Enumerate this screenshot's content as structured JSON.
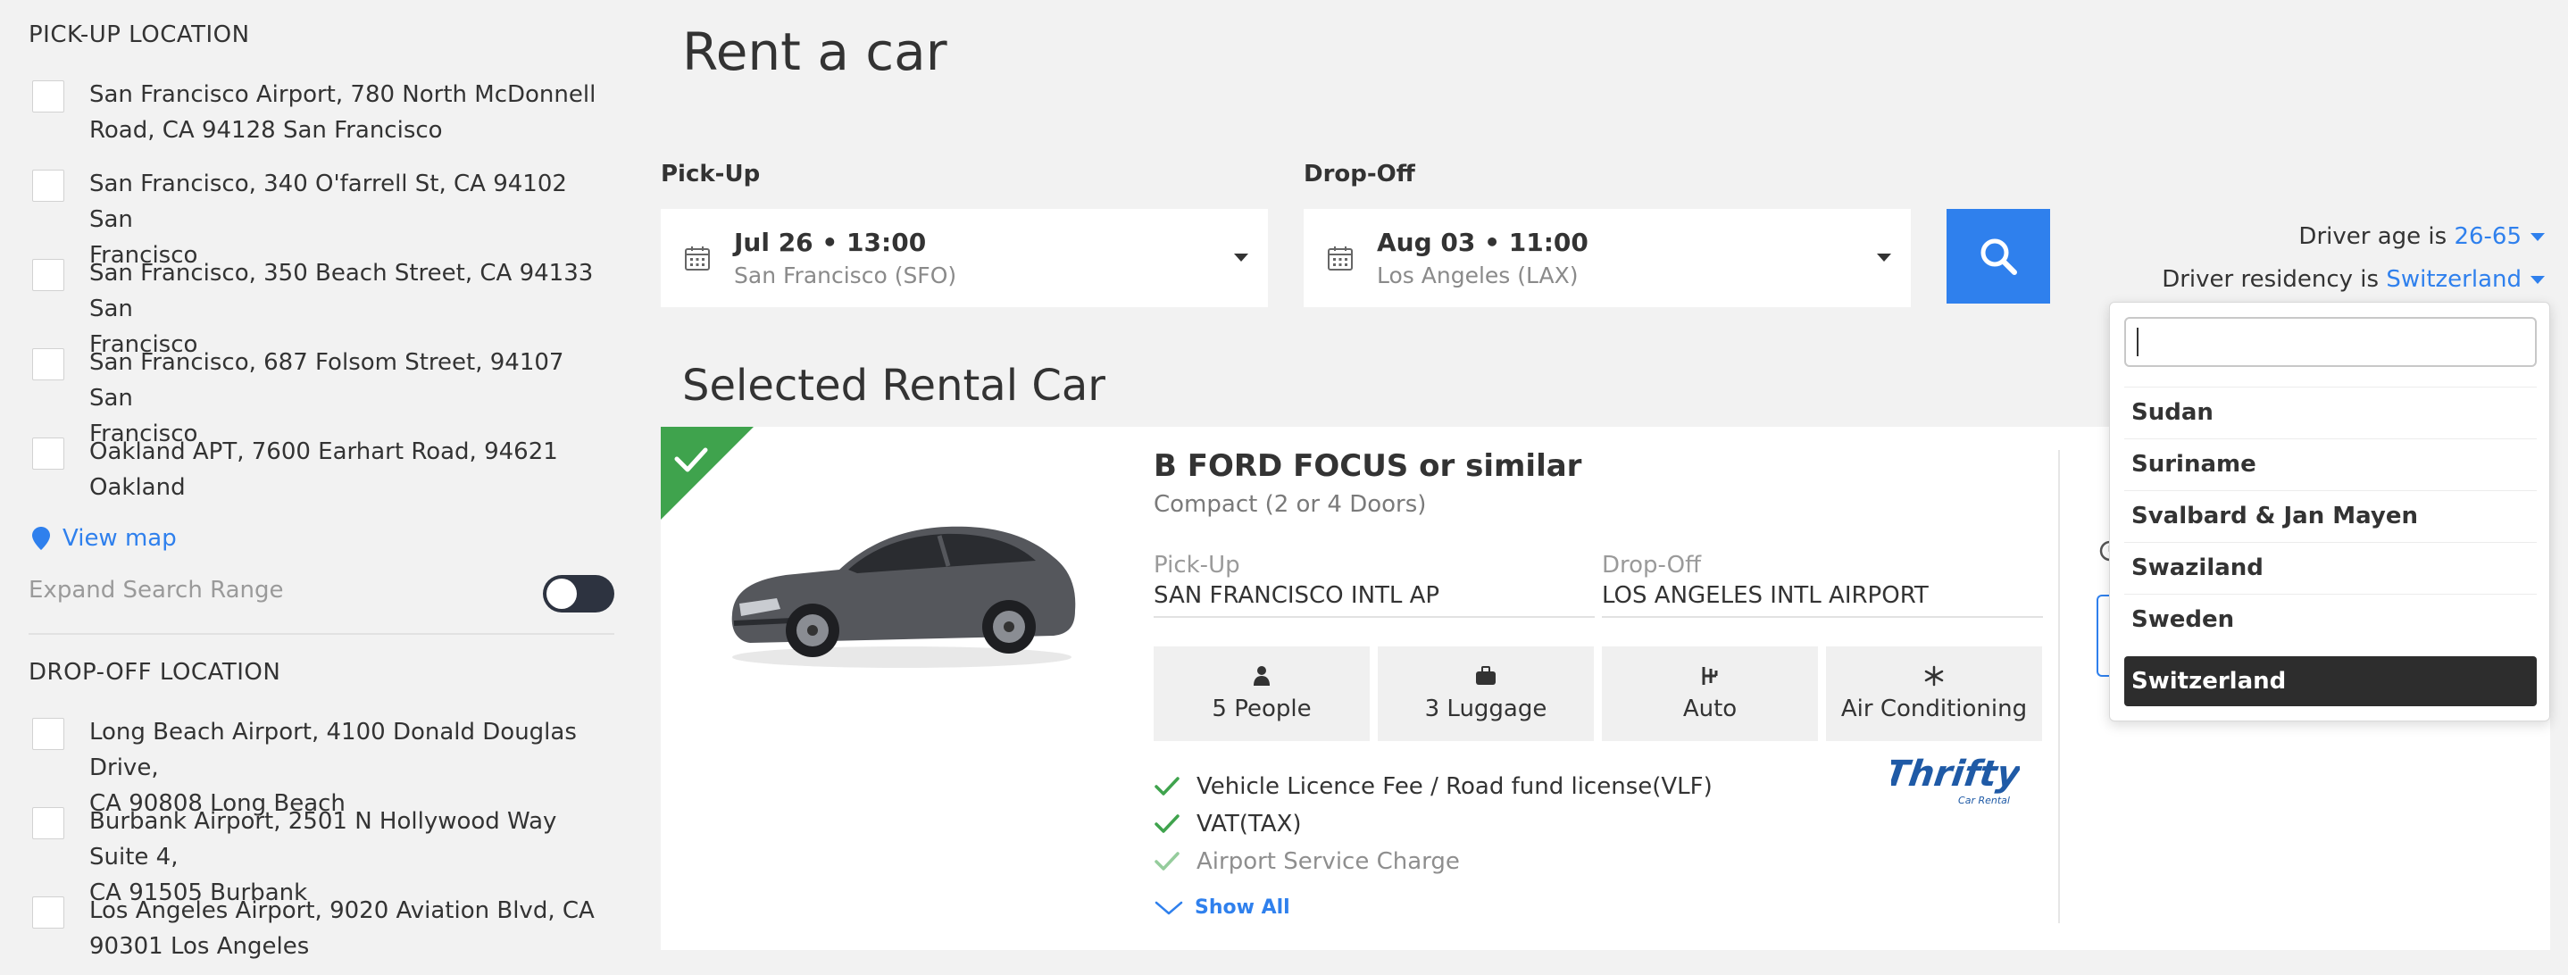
{
  "sidebar": {
    "pickup_title": "PICK-UP LOCATION",
    "pickup_items": [
      {
        "line1": "San Francisco Airport, 780 North McDonnell",
        "line2": "Road, CA 94128 San Francisco"
      },
      {
        "line1": "San Francisco, 340 O'farrell St, CA 94102 San",
        "line2": "Francisco"
      },
      {
        "line1": "San Francisco, 350 Beach Street, CA 94133 San",
        "line2": "Francisco"
      },
      {
        "line1": "San Francisco, 687 Folsom Street, 94107 San",
        "line2": "Francisco"
      },
      {
        "line1": "Oakland APT, 7600 Earhart Road, 94621",
        "line2": "Oakland"
      }
    ],
    "view_map": "View map",
    "expand_range": "Expand Search Range",
    "dropoff_title": "DROP-OFF LOCATION",
    "dropoff_items": [
      {
        "line1": "Long Beach Airport, 4100 Donald Douglas Drive,",
        "line2": "CA 90808 Long Beach"
      },
      {
        "line1": "Burbank Airport, 2501 N Hollywood Way Suite 4,",
        "line2": "CA 91505 Burbank"
      },
      {
        "line1": "Los Angeles Airport, 9020 Aviation Blvd, CA",
        "line2": "90301 Los Angeles"
      }
    ]
  },
  "header": {
    "title": "Rent a car"
  },
  "search": {
    "pickup_label": "Pick-Up",
    "pickup_date": "Jul 26 • 13:00",
    "pickup_place": "San Francisco (SFO)",
    "dropoff_label": "Drop-Off",
    "dropoff_date": "Aug 03 • 11:00",
    "dropoff_place": "Los Angeles (LAX)"
  },
  "driver": {
    "age_prefix": "Driver age is",
    "age_value": "26-65",
    "residency_prefix": "Driver residency is",
    "residency_value": "Switzerland"
  },
  "selected": {
    "heading": "Selected Rental Car",
    "car_name": "B FORD FOCUS or similar",
    "car_class": "Compact (2 or 4 Doors)",
    "pickup_label": "Pick-Up",
    "pickup_value": "SAN FRANCISCO INTL AP",
    "dropoff_label": "Drop-Off",
    "dropoff_value": "LOS ANGELES INTL AIRPORT",
    "features": [
      "5 People",
      "3 Luggage",
      "Auto",
      "Air Conditioning"
    ],
    "feature_icons": [
      "person-icon",
      "luggage-icon",
      "gearbox-icon",
      "snowflake-icon"
    ],
    "inclusions": [
      "Vehicle Licence Fee / Road fund license(VLF)",
      "VAT(TAX)",
      "Airport Service Charge"
    ],
    "show_all": "Show All",
    "supplier_logo": "Thrifty"
  },
  "residency_dropdown": {
    "search_value": "",
    "options": [
      "Sudan",
      "Suriname",
      "Svalbard & Jan Mayen",
      "Swaziland",
      "Sweden",
      "Switzerland"
    ],
    "selected": "Switzerland"
  },
  "colors": {
    "accent": "#2f80ed",
    "check_green": "#3fa34d",
    "selected_option": "#2d2d2d",
    "toggle": "#2d3340"
  }
}
